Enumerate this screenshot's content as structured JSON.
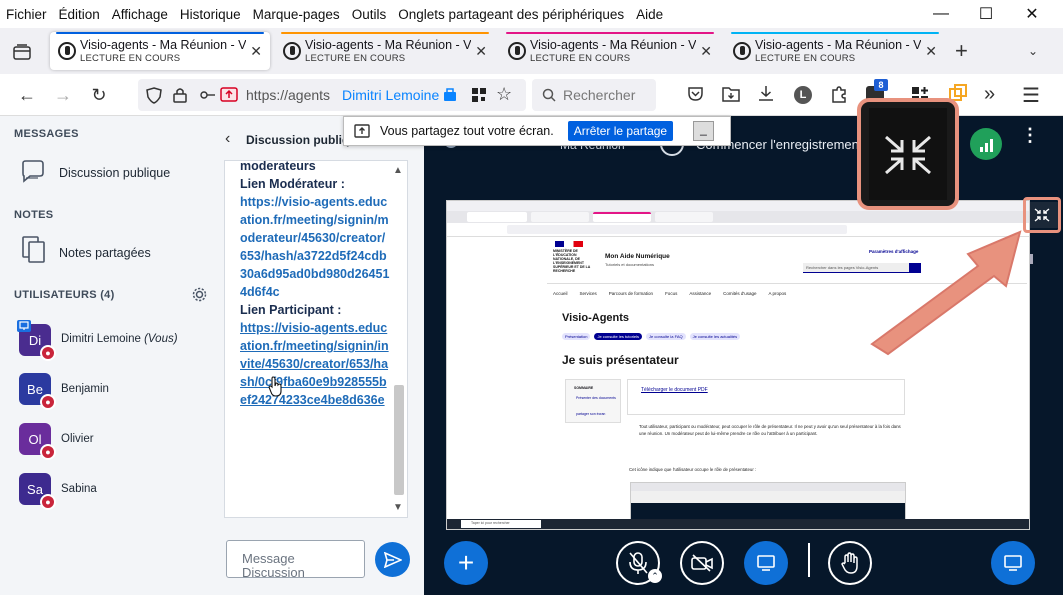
{
  "menubar": {
    "items": [
      "Fichier",
      "Édition",
      "Affichage",
      "Historique",
      "Marque-pages",
      "Outils",
      "Onglets partageant des périphériques",
      "Aide"
    ]
  },
  "tabs": [
    {
      "title": "Visio-agents - Ma Réunion - Vis",
      "subtitle": "LECTURE EN COURS",
      "line_color": "#0060df"
    },
    {
      "title": "Visio-agents - Ma Réunion - Vis",
      "subtitle": "LECTURE EN COURS",
      "line_color": "#ff9400"
    },
    {
      "title": "Visio-agents - Ma Réunion - Vis",
      "subtitle": "LECTURE EN COURS",
      "line_color": "#e31587"
    },
    {
      "title": "Visio-agents - Ma Réunion - Vis",
      "subtitle": "LECTURE EN COURS",
      "line_color": "#00b3f4"
    }
  ],
  "navbar": {
    "url_text": "https://agents",
    "container_label": "Dimitri Lemoine",
    "search_placeholder": "Rechercher",
    "ext_badge": "8",
    "account_letter": "L"
  },
  "left_panel": {
    "messages_heading": "MESSAGES",
    "public_chat": "Discussion publique",
    "notes_heading": "NOTES",
    "shared_notes": "Notes partagées",
    "users_heading": "UTILISATEURS (4)",
    "users": [
      {
        "initials": "Di",
        "name": "Dimitri Lemoine",
        "suffix": "(Vous)",
        "color": "#4a2c8f"
      },
      {
        "initials": "Be",
        "name": "Benjamin",
        "suffix": "",
        "color": "#2b3aa0"
      },
      {
        "initials": "Ol",
        "name": "Olivier",
        "suffix": "",
        "color": "#6a2d9c"
      },
      {
        "initials": "Sa",
        "name": "Sabina",
        "suffix": "",
        "color": "#3d2a8f"
      }
    ]
  },
  "chat": {
    "header": "Discussion publiq",
    "top_partial": "moderateurs",
    "mod_label": "Lien Modérateur :",
    "mod_link": "https://visio-agents.education.fr/meeting/signin/moderateur/45630/creator/653/hash/a3722d5f24cdb30a6d95ad0bd980d264514d6f4c",
    "part_label": "Lien Participant :",
    "part_link": "https://visio-agents.education.fr/meeting/signin/invite/45630/creator/653/hash/0cf9fba60e9b928555bef24274233ce4be8d636e",
    "input_placeholder": "Message Discussion"
  },
  "sharebar": {
    "message": "Vous partagez tout votre écran.",
    "stop_label": "Arrêter le partage",
    "minimize_label": "_"
  },
  "stage": {
    "meeting_name": "Ma Réunion",
    "record_label": "Commencer l'enregistrement"
  },
  "shared_screen": {
    "site_title": "Mon Aide Numérique",
    "site_subtitle": "Tutoriels et documentations",
    "ministry": "MINISTÈRE DE L'ÉDUCATION NATIONALE, DE L'ENSEIGNEMENT SUPÉRIEUR ET DE LA RECHERCHE",
    "display_params": "Paramètres d'affichage",
    "search_placeholder": "Rechercher dans les pages Visio-Agents",
    "nav": [
      "Accueil",
      "Services",
      "Parcours de formation",
      "Focus",
      "Assistance",
      "Comités d'usage",
      "A propos"
    ],
    "page_title": "Visio-Agents",
    "pills": [
      "Présentation",
      "Je consulte les tutoriels",
      "Je consulte la FAQ",
      "Je consulte les actualités"
    ],
    "heading": "Je suis présentateur",
    "sommaire": "SOMMAIRE",
    "toc": [
      "Présenter des documents",
      "partager son écran"
    ],
    "download": "Télécharger le document PDF",
    "para1": "Tout utilisateur, participant ou modérateur, peut occuper le rôle de présentateur. Il ne peut y avoir qu'un seul présentateur à la fois dans une réunion. Un modérateur peut de lui-même prendre ce rôle ou l'attribuer à un participant.",
    "para2": "Cet icône indique que l'utilisateur occupe le rôle de présentateur :",
    "taskbar_search": "Taper ici pour rechercher"
  },
  "colors": {
    "accent": "#0f70d7",
    "highlight": "#e8927e",
    "stage_bg": "#06172a",
    "mod_red": "#c9253b"
  }
}
